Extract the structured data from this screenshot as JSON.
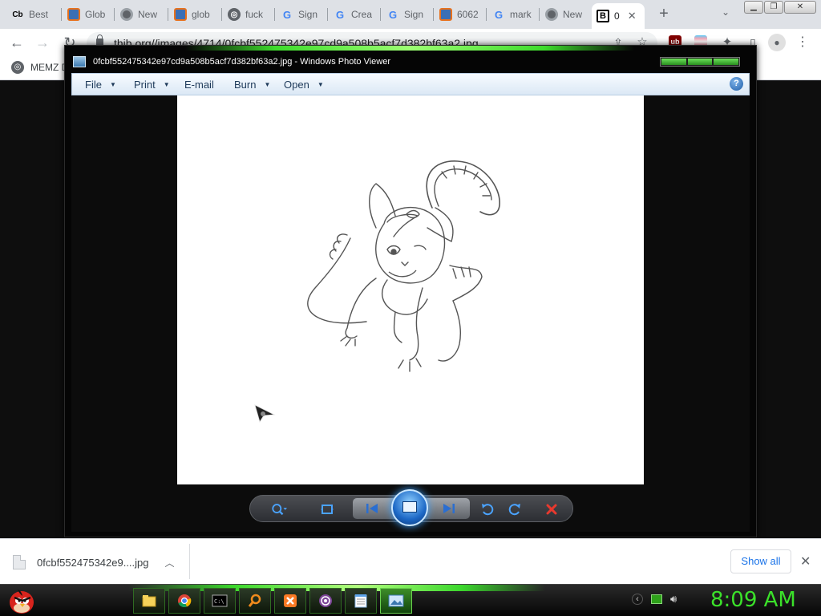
{
  "browser": {
    "tabs": [
      {
        "label": "Best",
        "favicon": "Cb",
        "fav_color": "#ffffff"
      },
      {
        "label": "Glob",
        "favicon": "orange-square",
        "fav_color": "#e8711c"
      },
      {
        "label": "New",
        "favicon": "chrome",
        "fav_color": "#5f6368"
      },
      {
        "label": "glob",
        "favicon": "orange-square",
        "fav_color": "#e8711c"
      },
      {
        "label": "fuck",
        "favicon": "globe",
        "fav_color": "#5f6368"
      },
      {
        "label": "Sign",
        "favicon": "G",
        "fav_color": "#4285f4"
      },
      {
        "label": "Crea",
        "favicon": "G",
        "fav_color": "#4285f4"
      },
      {
        "label": "Sign",
        "favicon": "G",
        "fav_color": "#4285f4"
      },
      {
        "label": "6062",
        "favicon": "orange-square",
        "fav_color": "#e8711c"
      },
      {
        "label": "mark",
        "favicon": "G",
        "fav_color": "#4285f4"
      },
      {
        "label": "New",
        "favicon": "chrome",
        "fav_color": "#5f6368"
      },
      {
        "label": "0",
        "favicon": "B",
        "fav_color": "#000000"
      }
    ],
    "url": "thib.org//images/4714/0fcbf552475342e97cd9a508b5acf7d382bf63a2.jpg",
    "bookmark": "MEMZ D"
  },
  "viewer": {
    "title": "0fcbf552475342e97cd9a508b5acf7d382bf63a2.jpg - Windows Photo Viewer",
    "menus": [
      "File",
      "Print",
      "E-mail",
      "Burn",
      "Open"
    ],
    "help": "?"
  },
  "downloads": {
    "file": "0fcbf552475342e9....jpg",
    "show_all": "Show all"
  },
  "taskbar": {
    "clock": "8:09 AM",
    "accent": "#3be12a"
  }
}
